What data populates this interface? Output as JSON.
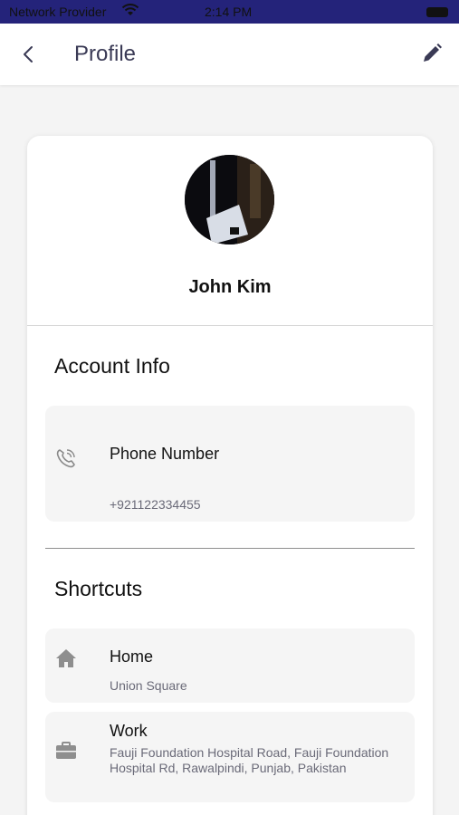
{
  "status_bar": {
    "carrier": "Network Provider",
    "time": "2:14 PM"
  },
  "header": {
    "title": "Profile",
    "back_icon": "chevron-left-icon",
    "edit_icon": "pencil-icon"
  },
  "profile": {
    "name": "John Kim"
  },
  "account_info": {
    "heading": "Account Info",
    "phone": {
      "label": "Phone Number",
      "value": "+921122334455",
      "icon": "phone-icon"
    }
  },
  "shortcuts": {
    "heading": "Shortcuts",
    "items": [
      {
        "label": "Home",
        "value": "Union Square",
        "icon": "home-icon"
      },
      {
        "label": "Work",
        "value": "Fauji Foundation Hospital Road, Fauji Foundation Hospital Rd, Rawalpindi, Punjab, Pakistan",
        "icon": "briefcase-icon"
      }
    ]
  },
  "colors": {
    "status_bar": "#24237a",
    "background": "#f4f4f4",
    "card": "#ffffff",
    "tile": "#f5f5f5",
    "title_text": "#3a3a55",
    "secondary_text": "#6a6a78"
  }
}
